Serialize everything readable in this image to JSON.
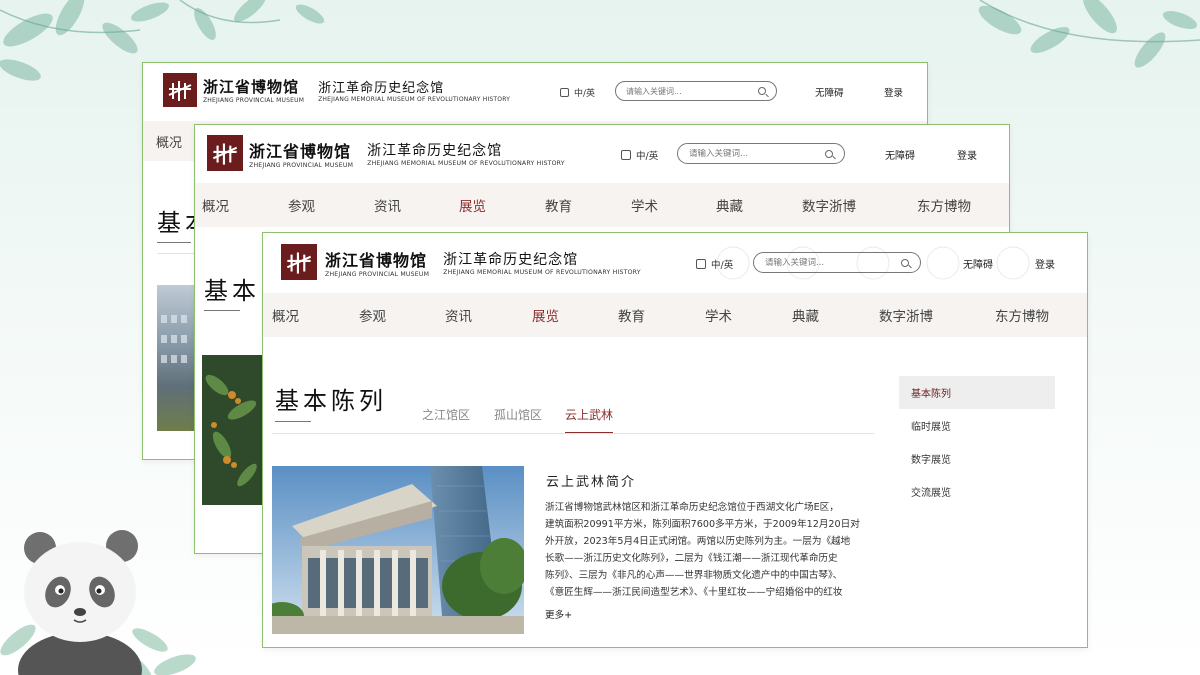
{
  "logo": {
    "cn": "浙江省博物馆",
    "en": "ZHEJIANG PROVINCIAL MUSEUM"
  },
  "memorial": {
    "cn": "浙江革命历史纪念馆",
    "en": "ZHEJIANG MEMORIAL MUSEUM OF REVOLUTIONARY HISTORY"
  },
  "header": {
    "lang": "中/英",
    "search_placeholder": "请输入关键词...",
    "accessibility": "无障碍",
    "login": "登录"
  },
  "nav": {
    "items": [
      "概况",
      "参观",
      "资讯",
      "展览",
      "教育",
      "学术",
      "典藏",
      "数字浙博",
      "东方博物"
    ],
    "active_index": 3
  },
  "page": {
    "title": "基本陈列",
    "tabs": [
      "之江馆区",
      "孤山馆区",
      "云上武林"
    ],
    "active_tab": 2
  },
  "sidebar": {
    "items": [
      "基本陈列",
      "临时展览",
      "数字展览",
      "交流展览"
    ],
    "active_index": 0
  },
  "article": {
    "title": "云上武林简介",
    "lines": [
      "浙江省博物馆武林馆区和浙江革命历史纪念馆位于西湖文化广场E区，",
      "建筑面积20991平方米，陈列面积7600多平方米，于2009年12月20日对",
      "外开放，2023年5月4日正式闭馆。两馆以历史陈列为主。一层为《越地",
      "长歌——浙江历史文化陈列》，二层为《钱江潮——浙江现代革命历史",
      "陈列》、三层为《非凡的心声——世界非物质文化遗产中的中国古琴》、",
      "《意匠生辉——浙江民间造型艺术》、《十里红妆——宁绍婚俗中的红妆"
    ],
    "more": "更多+"
  },
  "colors": {
    "accent": "#8b2e2e",
    "logo_bg": "#6b1d1d",
    "window_border": "#8cc06e",
    "nav_bg": "#f6f3f1"
  }
}
